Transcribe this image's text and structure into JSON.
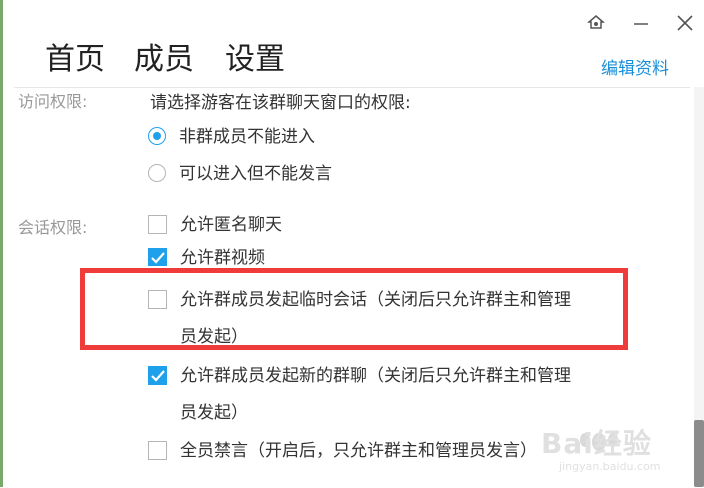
{
  "header": {
    "tabs": [
      {
        "label": "首页"
      },
      {
        "label": "成员"
      },
      {
        "label": "设置"
      }
    ],
    "edit_link": "编辑资料"
  },
  "window_controls": {
    "pin_icon": "pin-icon",
    "minimize_icon": "minimize-icon",
    "close_icon": "close-icon"
  },
  "access": {
    "label": "访问权限:",
    "prompt": "请选择游客在该群聊天窗口的权限:",
    "options": [
      {
        "label": "非群成员不能进入",
        "selected": true
      },
      {
        "label": "可以进入但不能发言",
        "selected": false
      }
    ]
  },
  "session": {
    "label": "会话权限:",
    "options": [
      {
        "label": "允许匿名聊天",
        "checked": false
      },
      {
        "label": "允许群视频",
        "checked": true
      },
      {
        "label": "允许群成员发起临时会话（关闭后只允许群主和管理员发起）",
        "line1": "允许群成员发起临时会话（关闭后只允许群主和管理",
        "line2": "员发起）",
        "checked": false
      },
      {
        "label": "允许群成员发起新的群聊（关闭后只允许群主和管理员发起）",
        "line1": "允许群成员发起新的群聊（关闭后只允许群主和管理",
        "line2": "员发起）",
        "checked": true
      },
      {
        "label": "全员禁言（开启后，只允许群主和管理员发言）",
        "checked": false
      }
    ]
  },
  "colors": {
    "accent": "#1ea1ea",
    "link": "#1a8fd8",
    "highlight": "#f03b3b"
  },
  "watermark": {
    "brand": "Bai经验",
    "url": "jingyan.baidu.com"
  }
}
